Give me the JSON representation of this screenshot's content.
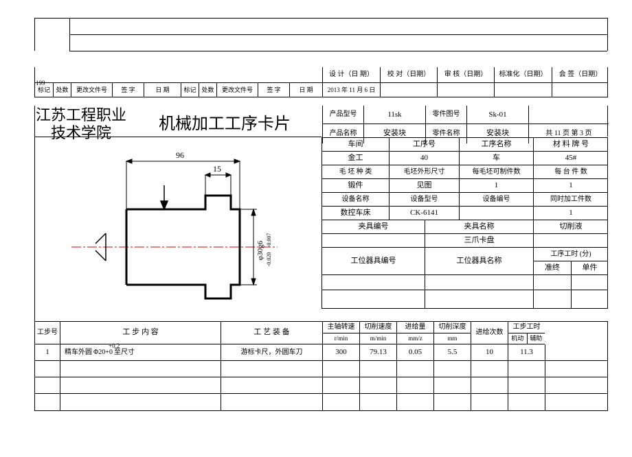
{
  "pageNum": "199",
  "topblank": {},
  "approve": {
    "h": [
      "设 计（日 期）",
      "校 对（日期）",
      "审 核（日期）",
      "标准化（日期）",
      "会 签（日期）"
    ],
    "date": "2013 年 11 月 6 日",
    "bottom": [
      "标记",
      "处数",
      "更改文件号",
      "签  字",
      "日  期",
      "标记",
      "处数",
      "更改文件号",
      "签  字",
      "日  期"
    ]
  },
  "school1": "江苏工程职业",
  "school2": "技术学院",
  "cardTitle": "机械加工工序卡片",
  "hdr": {
    "pmLabel": "产品型号",
    "pmVal": "11sk",
    "pnLabel": "零件图号",
    "pnVal": "Sk-01",
    "pnameLabel": "产品名称",
    "pnameVal": "安装块",
    "pnameLabel2": "零件名称",
    "pnameVal2": "安装块",
    "pages": "共 11 页 第  3 页"
  },
  "r1": {
    "a": "车间",
    "b": "工序号",
    "c": "工序名称",
    "d": "材 料 牌  号"
  },
  "r2": {
    "a": "金工",
    "b": "40",
    "c": "车",
    "d": "45#"
  },
  "r3": {
    "a": "毛 坯 种 类",
    "b": "毛坯外形尺寸",
    "c": "每毛坯可制件数",
    "d": "每 台 件 数"
  },
  "r4": {
    "a": "锻件",
    "b": "见图",
    "c": "1",
    "d": "1"
  },
  "r5": {
    "a": "设备名称",
    "b": "设备型号",
    "c": "设备编号",
    "d": "同时加工件数"
  },
  "r6": {
    "a": "数控车床",
    "b": "CK-6141",
    "c": "",
    "d": "1"
  },
  "r7": {
    "a": "夹具编号",
    "b": "夹具名称",
    "c": "切削液"
  },
  "r8": {
    "a": "",
    "b": "三爪卡盘",
    "c": ""
  },
  "r9": {
    "a": "工位器具编号",
    "b": "工位器具名称",
    "c": "工序工时 (分)"
  },
  "r10": {
    "a": "准终",
    "b": "单件"
  },
  "dim": {
    "w96": "96",
    "w15": "15",
    "dia": "φ30g6",
    "tol1": "-0.007",
    "tol2": "-0.020"
  },
  "stepHdr": {
    "no": "工步号",
    "content": "工    步    内    容",
    "equip": "工 艺 装 备",
    "spindle": "主轴转速",
    "spindleU": "r/min",
    "cut": "切削速度",
    "cutU": "m/min",
    "feed": "进给量",
    "feedU": "mm/z",
    "depth": "切削深度",
    "depthU": "mm",
    "cycles": "进给次数",
    "time": "工步工时",
    "timeA": "机动",
    "timeB": "辅助"
  },
  "step1": {
    "no": "1",
    "pre": "精车外圆",
    "phi": "Φ20+0",
    "tol": "+0.2",
    "suf": " 至尺寸",
    "equip": "游标卡尺，外圆车刀",
    "spindle": "300",
    "cut": "79.13",
    "feed": "0.05",
    "depth": "5.5",
    "cycles": "10",
    "timeA": "11.3",
    "timeB": ""
  }
}
